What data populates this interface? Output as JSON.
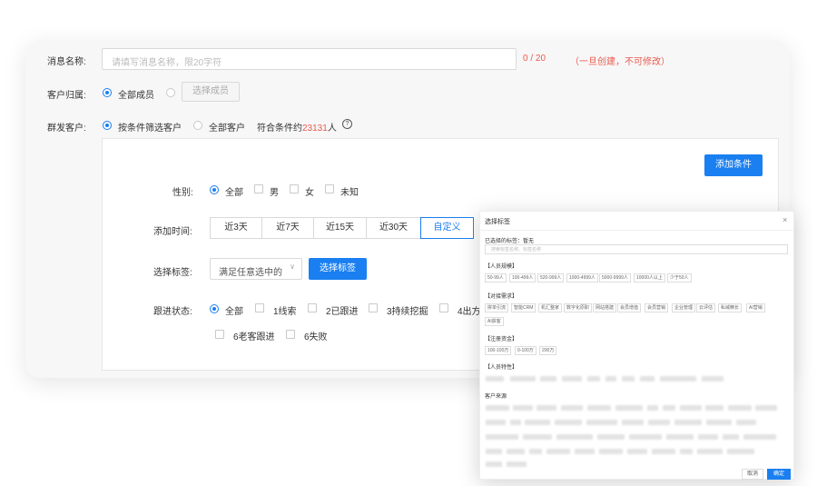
{
  "form": {
    "name_label": "消息名称:",
    "name_placeholder": "请填写消息名称，限20字符",
    "name_count": "0 / 20",
    "name_note": "（一旦创建，不可修改）",
    "owner_label": "客户归属:",
    "owner_all": "全部成员",
    "owner_select_button": "选择成员",
    "send_label": "群发客户:",
    "send_filter": "按条件筛选客户",
    "send_all": "全部客户",
    "match_prefix": "符合条件约",
    "match_count": "23131",
    "match_suffix": "人",
    "help_icon": "?"
  },
  "panel": {
    "add_condition_button": "添加条件",
    "gender_label": "性别:",
    "gender_options": [
      "全部",
      "男",
      "女",
      "未知"
    ],
    "time_label": "添加时间:",
    "time_options": [
      "近3天",
      "近7天",
      "近15天",
      "近30天",
      "自定义"
    ],
    "tag_label": "选择标签:",
    "tag_select_value": "满足任意选中的",
    "tag_select_button": "选择标签",
    "follow_label": "跟进状态:",
    "follow_options": [
      "全部",
      "1线索",
      "2已跟进",
      "3持续挖掘",
      "4出方"
    ],
    "follow_options_row2": [
      "6老客跟进",
      "6失败"
    ]
  },
  "dialog": {
    "title": "选择标签",
    "close_icon": "×",
    "selected_label": "已选择的标签：暂无",
    "search_placeholder": "搜索标签名称、标签名称",
    "group1_title": "【人员规模】",
    "group1_tags": [
      "50-99人",
      "100-499人",
      "520-999人",
      "1000-4999人",
      "5000-9999人",
      "10000人以上",
      "少于50人"
    ],
    "group2_title": "【对接需求】",
    "group2_tags": [
      "拼单引流",
      "智能CRM",
      "机汇整家",
      "数字化原职",
      "网站搭建",
      "会员增值",
      "会员营销",
      "企业管理",
      "云评估",
      "私域精长",
      "AI营销",
      "AI获客"
    ],
    "group3_title": "【注册资金】",
    "group3_tags": [
      "100-100万",
      "0-100万",
      "200万"
    ],
    "group4_title": "【人员特性】",
    "group5_title": "客户来源",
    "cancel_button": "取消",
    "confirm_button": "确定"
  }
}
